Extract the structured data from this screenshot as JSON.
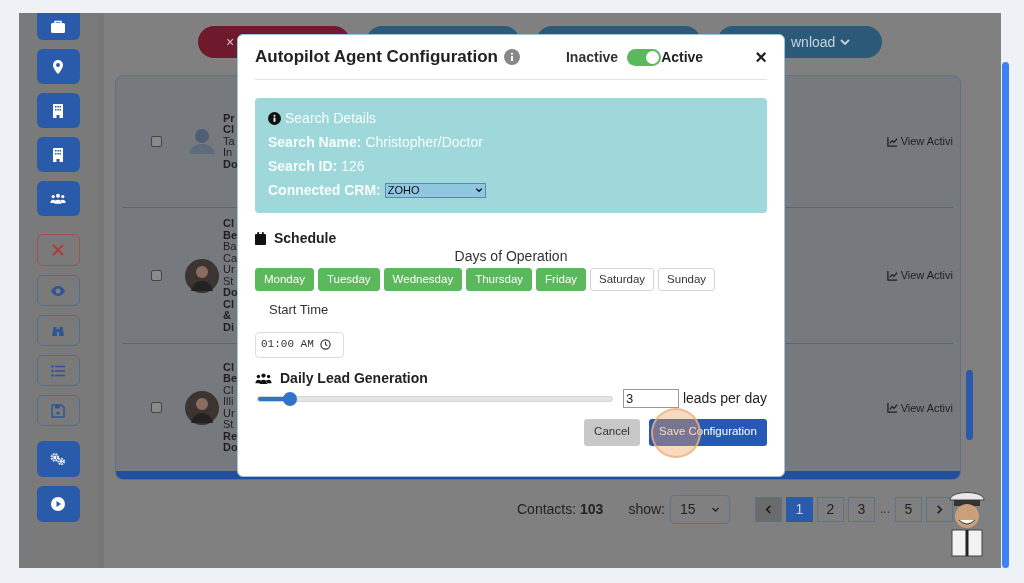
{
  "top_buttons": [
    {
      "kind": "danger",
      "label": "×"
    },
    {
      "kind": "primary"
    },
    {
      "kind": "primary"
    },
    {
      "kind": "primary",
      "label": "wnload",
      "dropdown": true
    }
  ],
  "contacts": [
    {
      "checked": false,
      "kind": "silhouette",
      "lines": [
        {
          "text": "Pr",
          "bold": true
        },
        {
          "text": "Cl",
          "bold": true
        },
        {
          "text": "Ta",
          "bold": false
        },
        {
          "text": "In",
          "bold": false
        },
        {
          "text": "Do",
          "bold": true
        }
      ],
      "action": "View Activi"
    },
    {
      "checked": false,
      "kind": "photo",
      "lines": [
        {
          "text": "Cl",
          "bold": true
        },
        {
          "text": "Be",
          "bold": true
        },
        {
          "text": "Ba",
          "bold": false
        },
        {
          "text": "Ca",
          "bold": false
        },
        {
          "text": "Ur",
          "bold": false
        },
        {
          "text": "St",
          "bold": false
        },
        {
          "text": "Do",
          "bold": true
        },
        {
          "text": "Cl",
          "bold": true
        },
        {
          "text": "&",
          "bold": true
        },
        {
          "text": "Di",
          "bold": true
        }
      ],
      "action": "View Activi"
    },
    {
      "checked": false,
      "kind": "photo",
      "lines": [
        {
          "text": "Cl",
          "bold": true
        },
        {
          "text": "Be",
          "bold": true
        },
        {
          "text": "Cl",
          "bold": false
        },
        {
          "text": "Illi",
          "bold": false
        },
        {
          "text": "Ur",
          "bold": false
        },
        {
          "text": "St",
          "bold": false
        },
        {
          "text": "Re",
          "bold": true
        },
        {
          "text": "Do",
          "bold": true
        }
      ],
      "action": "View Activi"
    }
  ],
  "footer": {
    "contacts_label": "Contacts:",
    "contacts_count": "103",
    "show_label": "show:",
    "page_size": "15",
    "pages": [
      {
        "kind": "prev",
        "selected": false
      },
      {
        "kind": "page",
        "label": "1",
        "selected": true
      },
      {
        "kind": "page",
        "label": "2",
        "selected": false
      },
      {
        "kind": "page",
        "label": "3",
        "selected": false
      },
      {
        "kind": "ellipsis",
        "label": "..."
      },
      {
        "kind": "page",
        "label": "5",
        "selected": false
      },
      {
        "kind": "next",
        "selected": false
      }
    ]
  },
  "modal": {
    "title": "Autopilot Agent Configuration",
    "toggle": {
      "off_label": "Inactive",
      "on_label": "Active",
      "on": true
    },
    "close": "×",
    "search_details": {
      "heading": "Search Details",
      "fields": [
        {
          "kind": "text",
          "label": "Search Name:",
          "value": "Christopher/Doctor"
        },
        {
          "kind": "text",
          "label": "Search ID:",
          "value": "126"
        },
        {
          "kind": "select",
          "label": "Connected CRM:",
          "value": "ZOHO"
        }
      ]
    },
    "schedule": {
      "heading": "Schedule",
      "days_label": "Days of Operation",
      "days": [
        {
          "label": "Monday",
          "selected": true
        },
        {
          "label": "Tuesday",
          "selected": true
        },
        {
          "label": "Wednesday",
          "selected": true
        },
        {
          "label": "Thursday",
          "selected": true
        },
        {
          "label": "Friday",
          "selected": true
        },
        {
          "label": "Saturday",
          "selected": false
        },
        {
          "label": "Sunday",
          "selected": false
        }
      ],
      "start_time_label": "Start Time",
      "start_time": "01:00 AM"
    },
    "leads": {
      "heading": "Daily Lead Generation",
      "level": 0.09,
      "value": "3",
      "unit": "leads per day"
    },
    "buttons": [
      {
        "kind": "secondary",
        "label": "Cancel"
      },
      {
        "kind": "primary",
        "label": "Save Configuration",
        "clicked": true
      }
    ]
  }
}
